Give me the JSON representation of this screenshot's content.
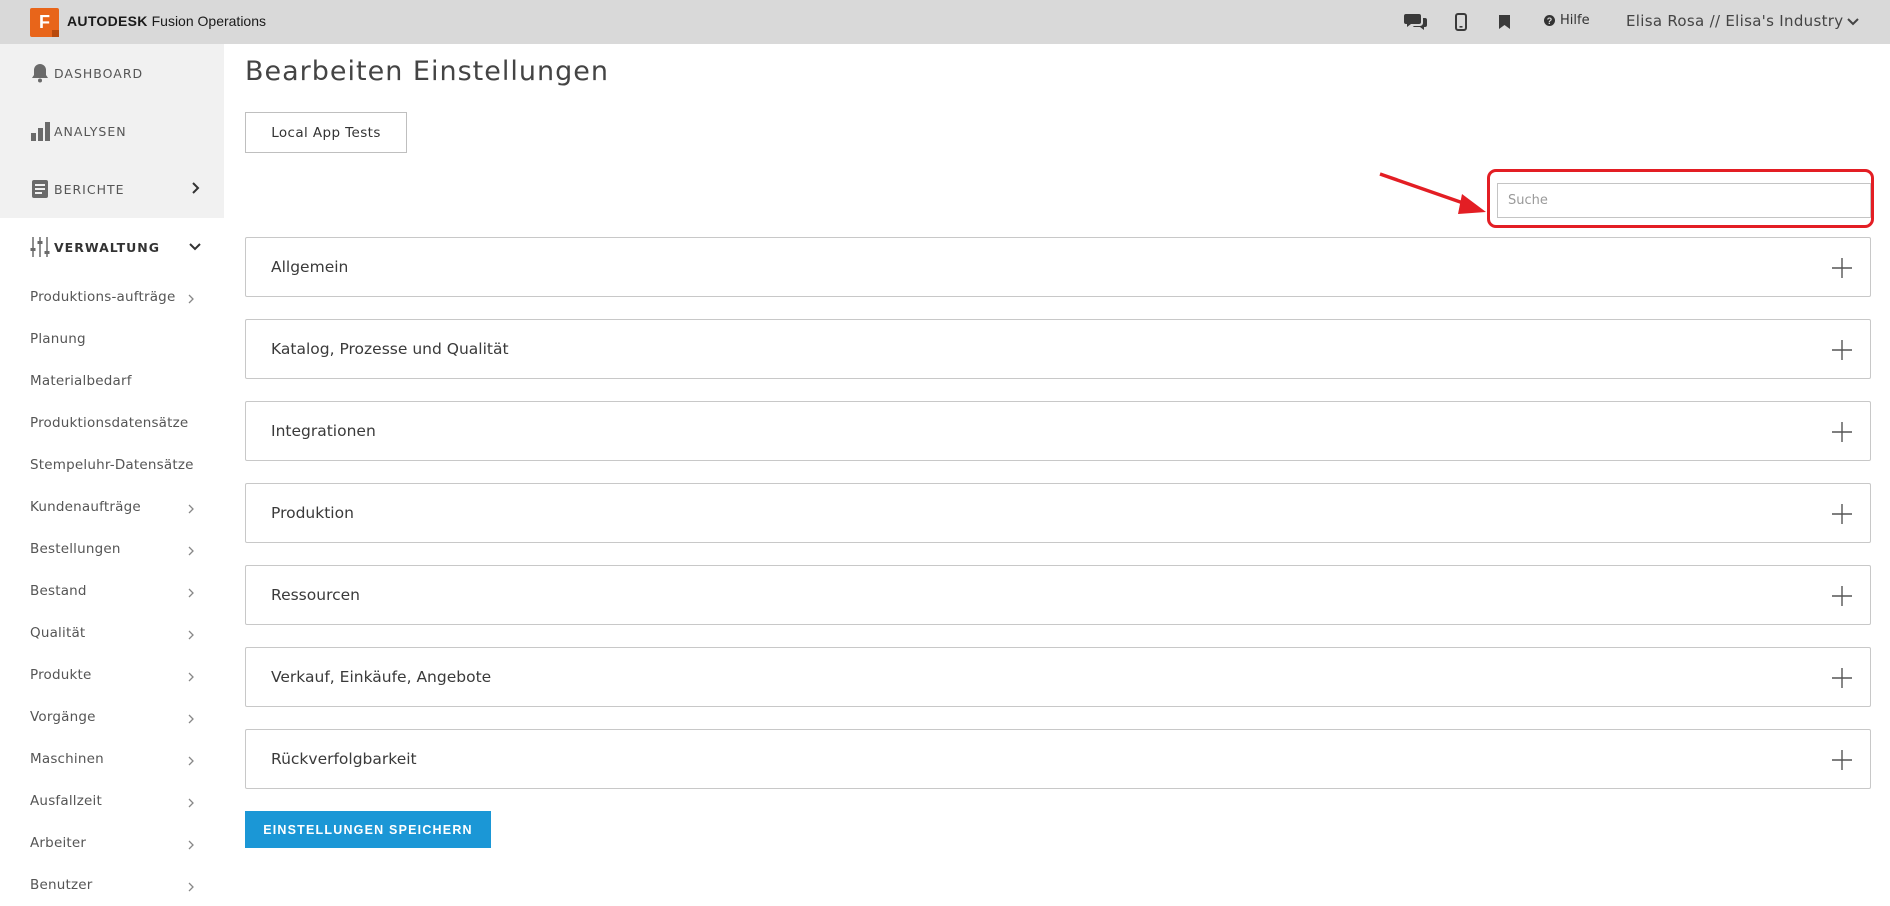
{
  "header": {
    "logo_letter": "F",
    "brand": "AUTODESK",
    "product": "Fusion Operations",
    "help_label": "Hilfe",
    "user_label": "Elisa Rosa // Elisa's Industry",
    "icons": [
      "chat-icon",
      "mobile-icon",
      "bookmark-icon",
      "help-icon",
      "chevron-down-icon"
    ]
  },
  "sidebar": {
    "main_items": [
      {
        "label": "DASHBOARD",
        "icon": "bell-icon"
      },
      {
        "label": "ANALYSEN",
        "icon": "bar-chart-icon"
      },
      {
        "label": "BERICHTE",
        "icon": "report-icon"
      },
      {
        "label": "VERWALTUNG",
        "icon": "sliders-icon"
      }
    ],
    "sub_items": [
      {
        "label": "Produktions-aufträge",
        "has_arrow": true
      },
      {
        "label": "Planung",
        "has_arrow": false
      },
      {
        "label": "Materialbedarf",
        "has_arrow": false
      },
      {
        "label": "Produktionsdatensätze",
        "has_arrow": false
      },
      {
        "label": "Stempeluhr-Datensätze",
        "has_arrow": false
      },
      {
        "label": "Kundenaufträge",
        "has_arrow": true
      },
      {
        "label": "Bestellungen",
        "has_arrow": true
      },
      {
        "label": "Bestand",
        "has_arrow": true
      },
      {
        "label": "Qualität",
        "has_arrow": true
      },
      {
        "label": "Produkte",
        "has_arrow": true
      },
      {
        "label": "Vorgänge",
        "has_arrow": true
      },
      {
        "label": "Maschinen",
        "has_arrow": true
      },
      {
        "label": "Ausfallzeit",
        "has_arrow": true
      },
      {
        "label": "Arbeiter",
        "has_arrow": true
      },
      {
        "label": "Benutzer",
        "has_arrow": true
      }
    ]
  },
  "main": {
    "title": "Bearbeiten Einstellungen",
    "tab_label": "Local App Tests",
    "search_placeholder": "Suche",
    "panels": [
      "Allgemein",
      "Katalog, Prozesse und Qualität",
      "Integrationen",
      "Produktion",
      "Ressourcen",
      "Verkauf, Einkäufe, Angebote",
      "Rückverfolgbarkeit"
    ],
    "save_label": "EINSTELLUNGEN SPEICHERN"
  },
  "colors": {
    "topbar": "#d9d9d9",
    "brand_orange": "#e8651a",
    "primary_button": "#1b97d6",
    "highlight_red": "#e31e24",
    "sidebar_bg": "#f1f1f1"
  }
}
